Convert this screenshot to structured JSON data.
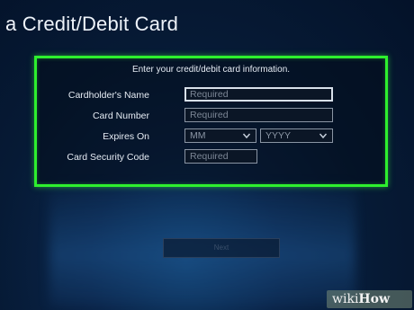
{
  "page": {
    "title": "a Credit/Debit Card"
  },
  "form": {
    "instruction": "Enter your credit/debit card information.",
    "cardholder_name": {
      "label": "Cardholder's Name",
      "placeholder": "Required"
    },
    "card_number": {
      "label": "Card Number",
      "placeholder": "Required"
    },
    "expires_on": {
      "label": "Expires On",
      "month_value": "MM",
      "year_value": "YYYY"
    },
    "security_code": {
      "label": "Card Security Code",
      "placeholder": "Required"
    },
    "border_color": "#2ef02e"
  },
  "next_button": {
    "label": "Next"
  },
  "watermark": {
    "text_wiki": "wiki",
    "text_how": "How"
  },
  "icons": {
    "dropdown": "chevron-down-icon"
  }
}
